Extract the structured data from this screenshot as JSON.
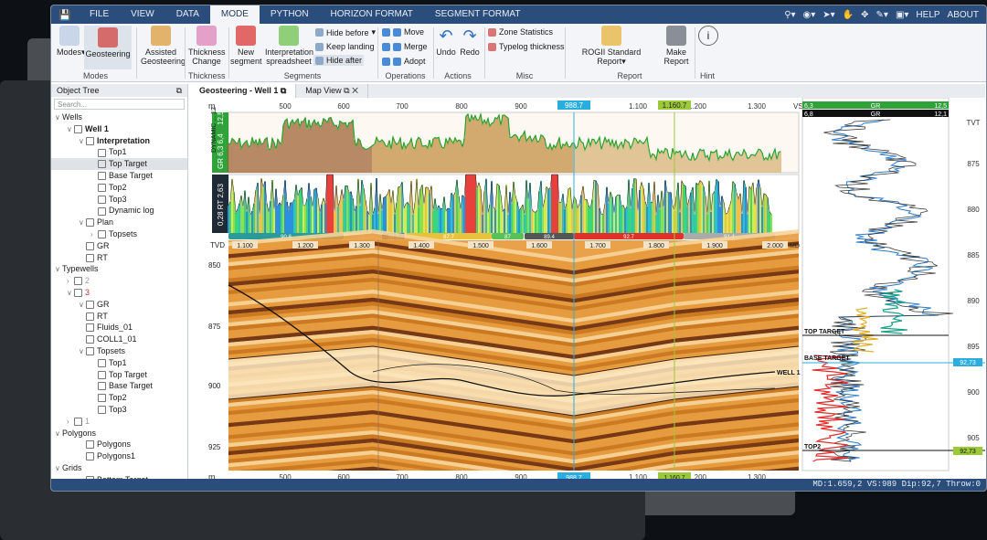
{
  "menu": {
    "tabs": [
      "FILE",
      "VIEW",
      "DATA",
      "MODE",
      "PYTHON",
      "HORIZON FORMAT",
      "SEGMENT FORMAT"
    ],
    "right": [
      "HELP",
      "ABOUT"
    ]
  },
  "ribbon": {
    "modes": "Modes",
    "geosteering": "Geosteering",
    "assisted": "Assisted Geosteering",
    "thickness": "Thickness Change",
    "new_segment": "New segment",
    "interp": "Interpretation spreadsheet",
    "hide_before": "Hide before",
    "keep_landing": "Keep landing",
    "hide_after": "Hide after",
    "move": "Move",
    "merge": "Merge",
    "adopt": "Adopt",
    "undo": "Undo",
    "redo": "Redo",
    "zone_stats": "Zone Statistics",
    "typelog": "Typelog thickness",
    "rogii": "ROGII Standard Report",
    "make_report": "Make Report",
    "hint": "Hint",
    "groups": [
      "Modes",
      "Thickness",
      "Segments",
      "Operations",
      "Actions",
      "Misc",
      "Report",
      "Hint"
    ]
  },
  "tree": {
    "title": "Object Tree",
    "search": "Search...",
    "nodes": [
      {
        "t": "Wells",
        "l": 0,
        "a": "v"
      },
      {
        "t": "Well 1",
        "l": 1,
        "a": "v",
        "b": true
      },
      {
        "t": "Interpretation",
        "l": 2,
        "a": "v",
        "b": true
      },
      {
        "t": "Top1",
        "l": 3
      },
      {
        "t": "Top Target",
        "l": 3,
        "s": true
      },
      {
        "t": "Base Target",
        "l": 3
      },
      {
        "t": "Top2",
        "l": 3
      },
      {
        "t": "Top3",
        "l": 3
      },
      {
        "t": "Dynamic log",
        "l": 3
      },
      {
        "t": "Plan",
        "l": 2,
        "a": "v"
      },
      {
        "t": "Topsets",
        "l": 3,
        "a": ">"
      },
      {
        "t": "GR",
        "l": 2
      },
      {
        "t": "RT",
        "l": 2
      },
      {
        "t": "Typewells",
        "l": 0,
        "a": "v"
      },
      {
        "t": "2",
        "l": 1,
        "a": ">"
      },
      {
        "t": "3",
        "l": 1,
        "a": "v"
      },
      {
        "t": "GR",
        "l": 2,
        "a": "v"
      },
      {
        "t": "RT",
        "l": 2
      },
      {
        "t": "Fluids_01",
        "l": 2
      },
      {
        "t": "COLL1_01",
        "l": 2
      },
      {
        "t": "Topsets",
        "l": 2,
        "a": "v"
      },
      {
        "t": "Top1",
        "l": 3
      },
      {
        "t": "Top Target",
        "l": 3
      },
      {
        "t": "Base Target",
        "l": 3
      },
      {
        "t": "Top2",
        "l": 3
      },
      {
        "t": "Top3",
        "l": 3
      },
      {
        "t": "1",
        "l": 1,
        "a": ">"
      },
      {
        "t": "Polygons",
        "l": 0,
        "a": "v"
      },
      {
        "t": "Polygons",
        "l": 2
      },
      {
        "t": "Polygons1",
        "l": 2
      },
      {
        "t": "Grids",
        "l": 0,
        "a": "v"
      },
      {
        "t": "Bottom Target",
        "l": 2
      }
    ]
  },
  "doc_tabs": [
    "Geosteering - Well 1",
    "Map View"
  ],
  "chart": {
    "vs_ticks": [
      "500",
      "600",
      "700",
      "800",
      "900",
      "1.100",
      "1.200",
      "1.300"
    ],
    "vs_label": "VS",
    "m_label": "m",
    "marker_blue": "988.7",
    "marker_green": "1.160.7",
    "md_ticks": [
      "1.100",
      "1.200",
      "1.300",
      "1.400",
      "1.500",
      "1.600",
      "1.700",
      "1.800",
      "1.900",
      "2.000"
    ],
    "md_label": "MD",
    "tvd_label": "TVD",
    "tvd_ticks": [
      "850",
      "875",
      "900",
      "925"
    ],
    "seg_vals": [
      "90.8",
      "90.3",
      "87.7",
      "87",
      "89.4",
      "92.7",
      "91.4"
    ],
    "gr_axis": [
      "12,5",
      "DYNAMIC ... 12",
      "6,4",
      "6,3",
      "GR"
    ],
    "rt_axis": [
      "2,63",
      "0,28",
      "RT"
    ],
    "well_label": "WELL 1",
    "right_gr_header1": {
      "l": "6,3",
      "m": "GR",
      "r": "12,5"
    },
    "right_gr_header2": {
      "l": "6,8",
      "m": "GR",
      "r": "12,1"
    },
    "tvt_label": "TVT",
    "tvt_ticks": [
      "875",
      "880",
      "885",
      "890",
      "895",
      "900",
      "905"
    ],
    "top_target": "TOP TARGET",
    "base_target": "BASE TARGET",
    "top2": "TOP2",
    "val_blue": "92,73",
    "val_green": "92,73"
  },
  "status": "MD:1.659,2  VS:989  Dip:92,7  Throw:0"
}
